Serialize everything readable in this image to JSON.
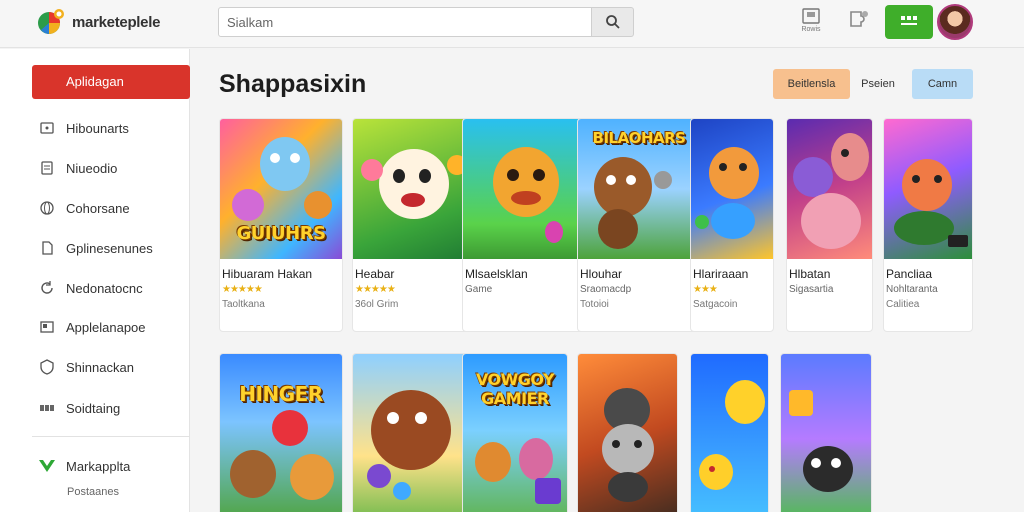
{
  "header": {
    "brand": "marketeplele",
    "search_placeholder": "Sialkam",
    "icon1_label": "Rowis",
    "green_button_label": "",
    "colors": {
      "accent_red": "#d9342b",
      "green": "#3fae2a"
    }
  },
  "sidebar": {
    "active_label": "Aplidagan",
    "items": [
      {
        "label": "Hibounarts",
        "icon": "tablet-icon"
      },
      {
        "label": "Niueodio",
        "icon": "document-icon"
      },
      {
        "label": "Cohorsane",
        "icon": "globe-icon"
      },
      {
        "label": "Gplinesenunes",
        "icon": "page-icon"
      },
      {
        "label": "Nedonatocnc",
        "icon": "refresh-icon"
      },
      {
        "label": "Applelanapoe",
        "icon": "card-icon"
      },
      {
        "label": "Shinnackan",
        "icon": "shield-icon"
      },
      {
        "label": "Soidtaing",
        "icon": "grid-icon"
      }
    ],
    "footer_label": "Markapplta",
    "footer_sub": "Postaanes"
  },
  "main": {
    "title": "Shappasixin",
    "filters": [
      "Beitlensla",
      "Pseien",
      "Camn"
    ]
  },
  "games": [
    {
      "name": "Hibuaram Hakan",
      "stars": "★★★★★",
      "sub": "Taoltkana",
      "banner": "GUIUHRS"
    },
    {
      "name": "Heabar",
      "stars": "★★★★★",
      "sub": "36ol Grim",
      "banner": ""
    },
    {
      "name": "Mlsaelsklan",
      "meta": "Game",
      "sub": "",
      "banner": ""
    },
    {
      "name": "Hlouhar",
      "meta": "Sraomacdp",
      "sub": "Totoioi",
      "banner": "BILAOHARS"
    },
    {
      "name": "Hlariraaan",
      "stars": "★★★",
      "sub": "Satgacoin",
      "banner": ""
    },
    {
      "name": "Hlbatan",
      "meta": "Sigasartia",
      "sub": "",
      "banner": ""
    },
    {
      "name": "Pancliaa",
      "meta": "Nohltaranta",
      "sub": "Calitiea",
      "banner": ""
    }
  ],
  "games_row2": [
    {
      "banner": "HINGER",
      "banner_top": ""
    },
    {
      "banner": "",
      "banner_top": ""
    },
    {
      "banner": "VOWGOY GAMIER",
      "banner_top": ""
    },
    {
      "banner": "",
      "banner_top": ""
    },
    {
      "banner": "",
      "banner_top": ""
    },
    {
      "banner": "",
      "banner_top": ""
    }
  ]
}
